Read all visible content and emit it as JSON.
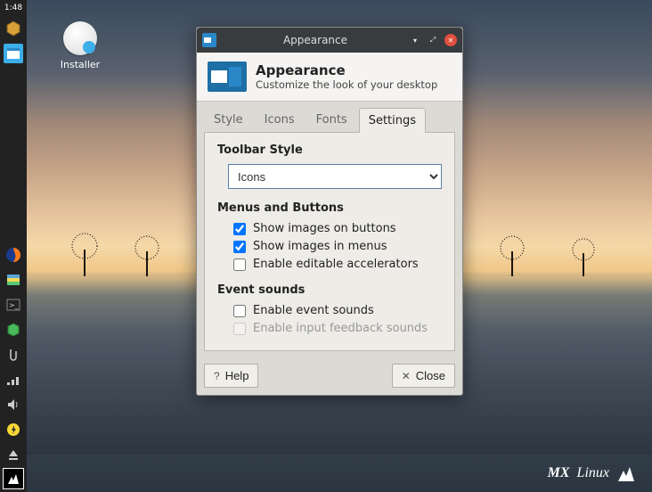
{
  "panel": {
    "time": "1:48"
  },
  "desktop": {
    "installer_label": "Installer"
  },
  "branding": {
    "text_mx": "MX",
    "text_linux": "Linux"
  },
  "window": {
    "title": "Appearance",
    "header_title": "Appearance",
    "header_subtitle": "Customize the look of your desktop",
    "tabs": {
      "style": "Style",
      "icons": "Icons",
      "fonts": "Fonts",
      "settings": "Settings"
    },
    "settings": {
      "toolbar_style": {
        "title": "Toolbar Style",
        "value": "Icons"
      },
      "menus_buttons": {
        "title": "Menus and Buttons",
        "show_images_buttons": {
          "label": "Show images on buttons",
          "checked": true
        },
        "show_images_menus": {
          "label": "Show images in menus",
          "checked": true
        },
        "editable_accel": {
          "label": "Enable editable accelerators",
          "checked": false
        }
      },
      "event_sounds": {
        "title": "Event sounds",
        "enable_event": {
          "label": "Enable event sounds",
          "checked": false
        },
        "enable_feedback": {
          "label": "Enable input feedback sounds",
          "checked": false,
          "disabled": true
        }
      }
    },
    "footer": {
      "help": "Help",
      "close": "Close"
    }
  }
}
